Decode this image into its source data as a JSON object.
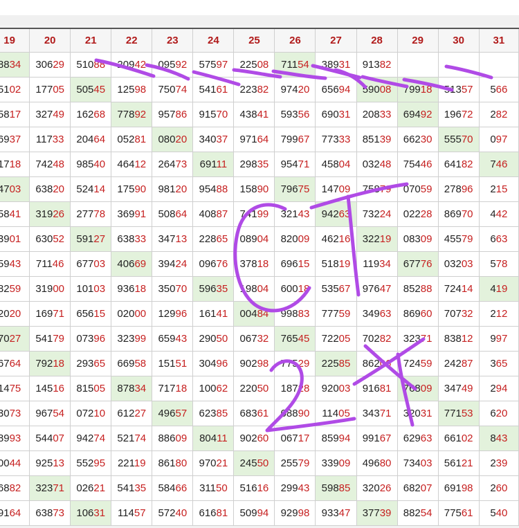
{
  "headers": [
    "19",
    "20",
    "21",
    "22",
    "23",
    "24",
    "25",
    "26",
    "27",
    "28",
    "29",
    "30",
    "31"
  ],
  "rows": [
    [
      "8834",
      "30629",
      "51088",
      "20942",
      "09592",
      "57597",
      "22508",
      "71154",
      "38931",
      "91382",
      "",
      "",
      ""
    ],
    [
      "5102",
      "17705",
      "50545",
      "12598",
      "75074",
      "54161",
      "22382",
      "97420",
      "65694",
      "59008",
      "79918",
      "51357",
      "566"
    ],
    [
      "5817",
      "32749",
      "16268",
      "77892",
      "95786",
      "91570",
      "43841",
      "59356",
      "69031",
      "20833",
      "69492",
      "19672",
      "282"
    ],
    [
      "6937",
      "11733",
      "20464",
      "05281",
      "08020",
      "34037",
      "97164",
      "79967",
      "77333",
      "85139",
      "66230",
      "55570",
      "097"
    ],
    [
      "1718",
      "74248",
      "98540",
      "46412",
      "26473",
      "69111",
      "29835",
      "95471",
      "45804",
      "03248",
      "75446",
      "64182",
      "746"
    ],
    [
      "4703",
      "63820",
      "52414",
      "17590",
      "98120",
      "95488",
      "15890",
      "79675",
      "14709",
      "75879",
      "07059",
      "27896",
      "215"
    ],
    [
      "5841",
      "31926",
      "27778",
      "36991",
      "50864",
      "40887",
      "74199",
      "32143",
      "94263",
      "73224",
      "02228",
      "86970",
      "442"
    ],
    [
      "3901",
      "63052",
      "59127",
      "63833",
      "34713",
      "22865",
      "08904",
      "82009",
      "46216",
      "32219",
      "08309",
      "45579",
      "663"
    ],
    [
      "5943",
      "71146",
      "67703",
      "40669",
      "39424",
      "09676",
      "37818",
      "69615",
      "51819",
      "11934",
      "67776",
      "03203",
      "578"
    ],
    [
      "8259",
      "31900",
      "10103",
      "93618",
      "35070",
      "59635",
      "19804",
      "60018",
      "53567",
      "97647",
      "85288",
      "72414",
      "419"
    ],
    [
      "2020",
      "16971",
      "65615",
      "02000",
      "12996",
      "16141",
      "00484",
      "99883",
      "77759",
      "34963",
      "86960",
      "70732",
      "212"
    ],
    [
      "7027",
      "54179",
      "07396",
      "32399",
      "65943",
      "29050",
      "06732",
      "76545",
      "72205",
      "70282",
      "32371",
      "83812",
      "997"
    ],
    [
      "6764",
      "79218",
      "29365",
      "66958",
      "15151",
      "30496",
      "90298",
      "77529",
      "22585",
      "86206",
      "72459",
      "24287",
      "365"
    ],
    [
      "1475",
      "14516",
      "81505",
      "87834",
      "71718",
      "10062",
      "22050",
      "18728",
      "92003",
      "91681",
      "76809",
      "34749",
      "294"
    ],
    [
      "3073",
      "96754",
      "07210",
      "61227",
      "49657",
      "62385",
      "68361",
      "08890",
      "11405",
      "34371",
      "32031",
      "77153",
      "620"
    ],
    [
      "8993",
      "54407",
      "94274",
      "52174",
      "88609",
      "80411",
      "90260",
      "06717",
      "85994",
      "99167",
      "62963",
      "66102",
      "843"
    ],
    [
      "0044",
      "92513",
      "55295",
      "22119",
      "86180",
      "97021",
      "24550",
      "25579",
      "33909",
      "49680",
      "73403",
      "56121",
      "239"
    ],
    [
      "6882",
      "32371",
      "02621",
      "54135",
      "58466",
      "31150",
      "51616",
      "29943",
      "59885",
      "32026",
      "68207",
      "69198",
      "260"
    ],
    [
      "9164",
      "63873",
      "10631",
      "11457",
      "57240",
      "61681",
      "50994",
      "92998",
      "93347",
      "37739",
      "88254",
      "77561",
      "540"
    ]
  ],
  "highlights": [
    [
      0,
      0
    ],
    [
      0,
      7
    ],
    [
      1,
      2
    ],
    [
      1,
      9
    ],
    [
      1,
      10
    ],
    [
      2,
      3
    ],
    [
      2,
      10
    ],
    [
      3,
      4
    ],
    [
      3,
      11
    ],
    [
      4,
      5
    ],
    [
      4,
      12
    ],
    [
      5,
      0
    ],
    [
      5,
      7
    ],
    [
      6,
      1
    ],
    [
      6,
      8
    ],
    [
      7,
      2
    ],
    [
      7,
      9
    ],
    [
      8,
      3
    ],
    [
      8,
      10
    ],
    [
      9,
      5
    ],
    [
      9,
      12
    ],
    [
      10,
      6
    ],
    [
      11,
      0
    ],
    [
      11,
      7
    ],
    [
      12,
      1
    ],
    [
      12,
      8
    ],
    [
      13,
      3
    ],
    [
      13,
      10
    ],
    [
      14,
      4
    ],
    [
      14,
      11
    ],
    [
      15,
      5
    ],
    [
      15,
      12
    ],
    [
      16,
      6
    ],
    [
      17,
      1
    ],
    [
      17,
      8
    ],
    [
      18,
      2
    ],
    [
      18,
      9
    ]
  ]
}
